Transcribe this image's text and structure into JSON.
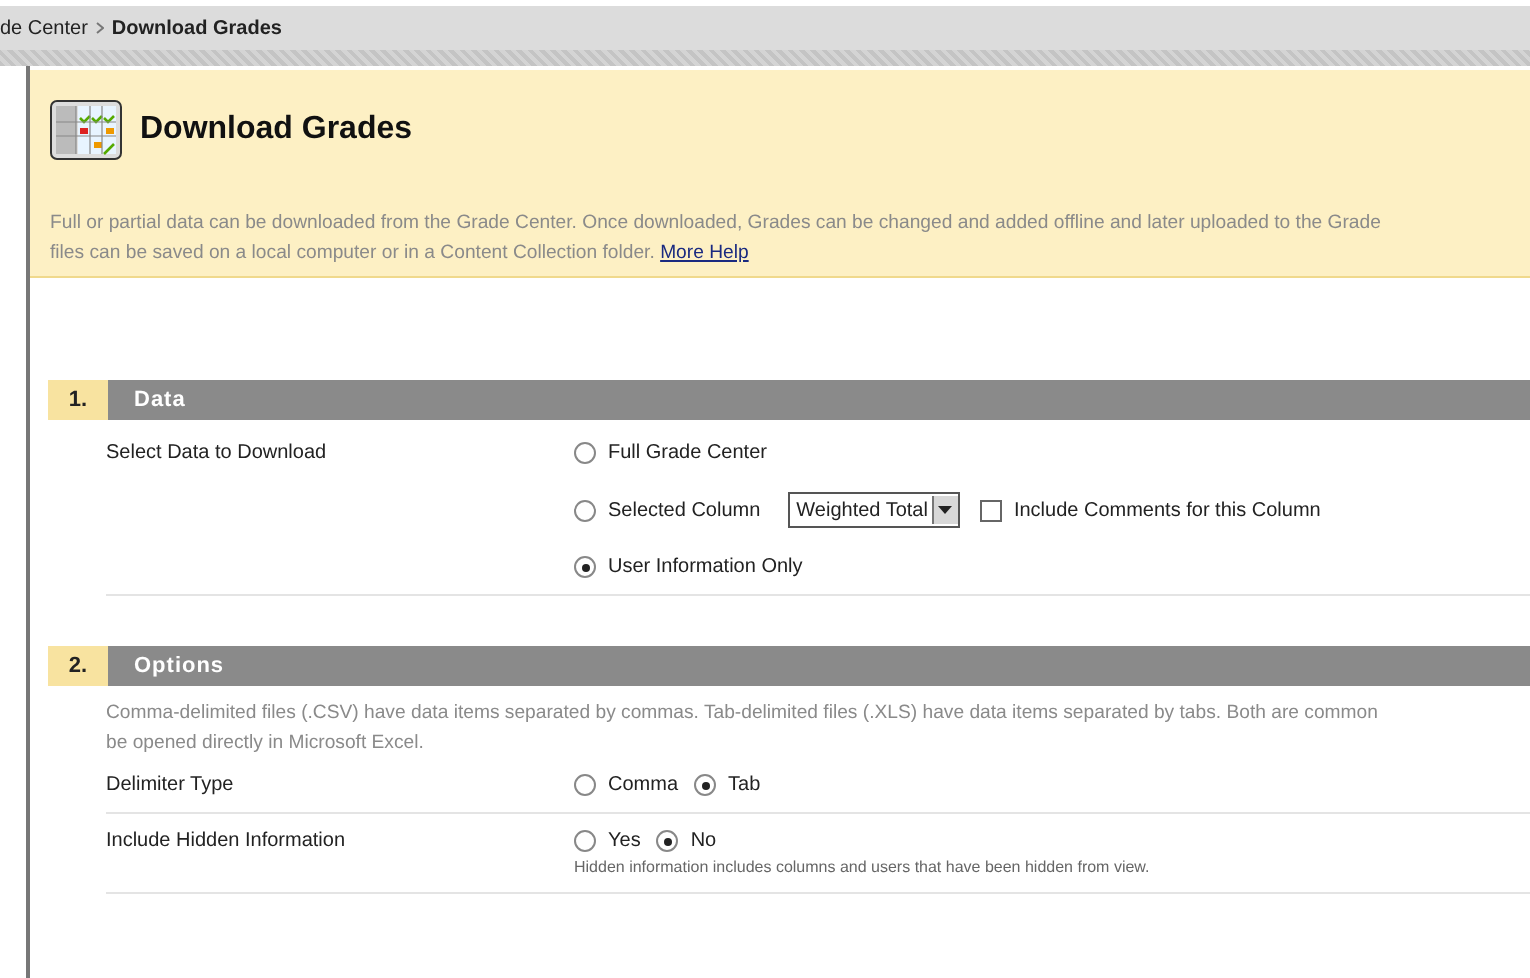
{
  "breadcrumb": [
    {
      "label": "de Center"
    },
    {
      "label": "Download Grades"
    }
  ],
  "header": {
    "title": "Download Grades",
    "description": [
      "Full or partial data can be downloaded from the Grade Center. Once downloaded, Grades can be changed and added offline and later uploaded to the Grade",
      "files can be saved on a local computer or in a Content Collection folder."
    ],
    "help_link": "More Help"
  },
  "sections": [
    {
      "number": "1.",
      "title": "Data",
      "rows": [
        {
          "label": "Select Data to Download",
          "choices": [
            {
              "kind": "radio",
              "label": "Full Grade Center",
              "selected": false
            },
            {
              "kind": "radio-select",
              "label": "Selected Column",
              "selected": false,
              "select_value": "Weighted Total",
              "checkbox_label": "Include Comments for this Column",
              "checked": false
            },
            {
              "kind": "radio",
              "label": "User Information Only",
              "selected": true
            }
          ]
        }
      ]
    },
    {
      "number": "2.",
      "title": "Options",
      "description": [
        "Comma-delimited files (.CSV) have data items separated by commas. Tab-delimited files (.XLS) have data items separated by tabs. Both are common",
        "be opened directly in Microsoft Excel."
      ],
      "rows": [
        {
          "label": "Delimiter Type",
          "choices": [
            {
              "kind": "radio",
              "label": "Comma",
              "selected": false
            },
            {
              "kind": "radio",
              "label": "Tab",
              "selected": true
            }
          ]
        },
        {
          "label": "Include Hidden Information",
          "choices": [
            {
              "kind": "radio",
              "label": "Yes",
              "selected": false
            },
            {
              "kind": "radio",
              "label": "No",
              "selected": true
            }
          ],
          "note": "Hidden information includes columns and users that have been hidden from view."
        }
      ]
    }
  ]
}
